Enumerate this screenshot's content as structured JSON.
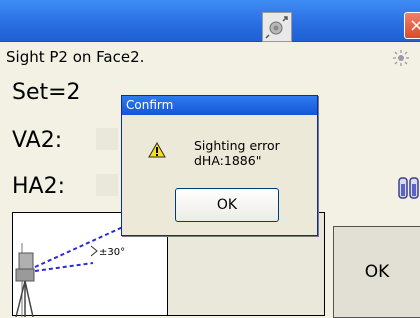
{
  "screen": {
    "instruction": "Sight P2 on Face2.",
    "set": {
      "label": "Set=2"
    },
    "va2": {
      "label": "VA2:",
      "value": ""
    },
    "ha2": {
      "label": "HA2:",
      "value": ""
    },
    "ok_label": "OK",
    "diagram": {
      "angle_label": "±30°"
    }
  },
  "titlebar": {
    "close_label": "×",
    "icons": [
      "target-tool-icon",
      "close-icon"
    ]
  },
  "dialog": {
    "title": "Confirm",
    "message_line1": "Sighting error",
    "message_line2": "dHA:1886\"",
    "ok_label": "OK",
    "icon": "warning-icon"
  },
  "colors": {
    "titlebar": "#2a6fe3",
    "background": "#f3f1e4",
    "close_button": "#d94a2a"
  }
}
